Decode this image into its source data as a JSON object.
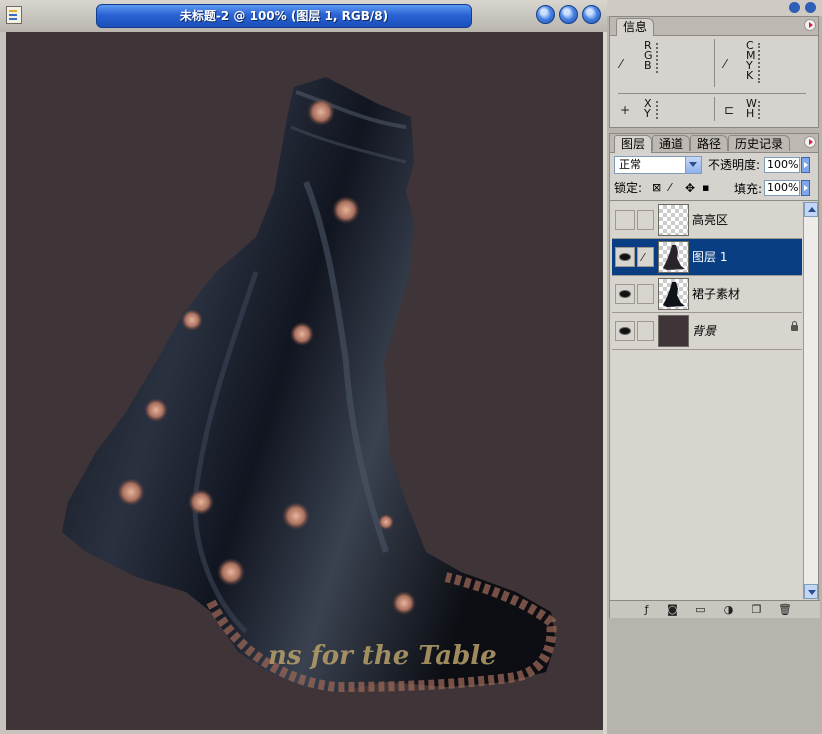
{
  "document": {
    "title": "未标题-2 @ 100% (图层 1, RGB/8)",
    "canvas_color": "#3f3437",
    "watermark_text": "ns for the Table"
  },
  "info_panel": {
    "tab": "信息",
    "rgb_labels": "R\nG\nB",
    "cmyk_labels": "C\nM\nY\nK",
    "xy_labels": "X\nY",
    "wh_labels": "W\nH"
  },
  "layers_panel": {
    "tabs": [
      "图层",
      "通道",
      "路径",
      "历史记录"
    ],
    "blend_mode": "正常",
    "opacity_label": "不透明度:",
    "opacity_value": "100%",
    "lock_label": "锁定:",
    "fill_label": "填充:",
    "fill_value": "100%",
    "layers": [
      {
        "name": "高亮区",
        "visible": false,
        "selected": false
      },
      {
        "name": "图层 1",
        "visible": true,
        "selected": true
      },
      {
        "name": "裙子素材",
        "visible": true,
        "selected": false
      },
      {
        "name": "背景",
        "visible": true,
        "selected": false,
        "locked": true
      }
    ]
  },
  "colors": {
    "title_blue": "#2a63d4",
    "selected_layer": "#0a3e82",
    "panel_bg": "#d6d3ce"
  }
}
